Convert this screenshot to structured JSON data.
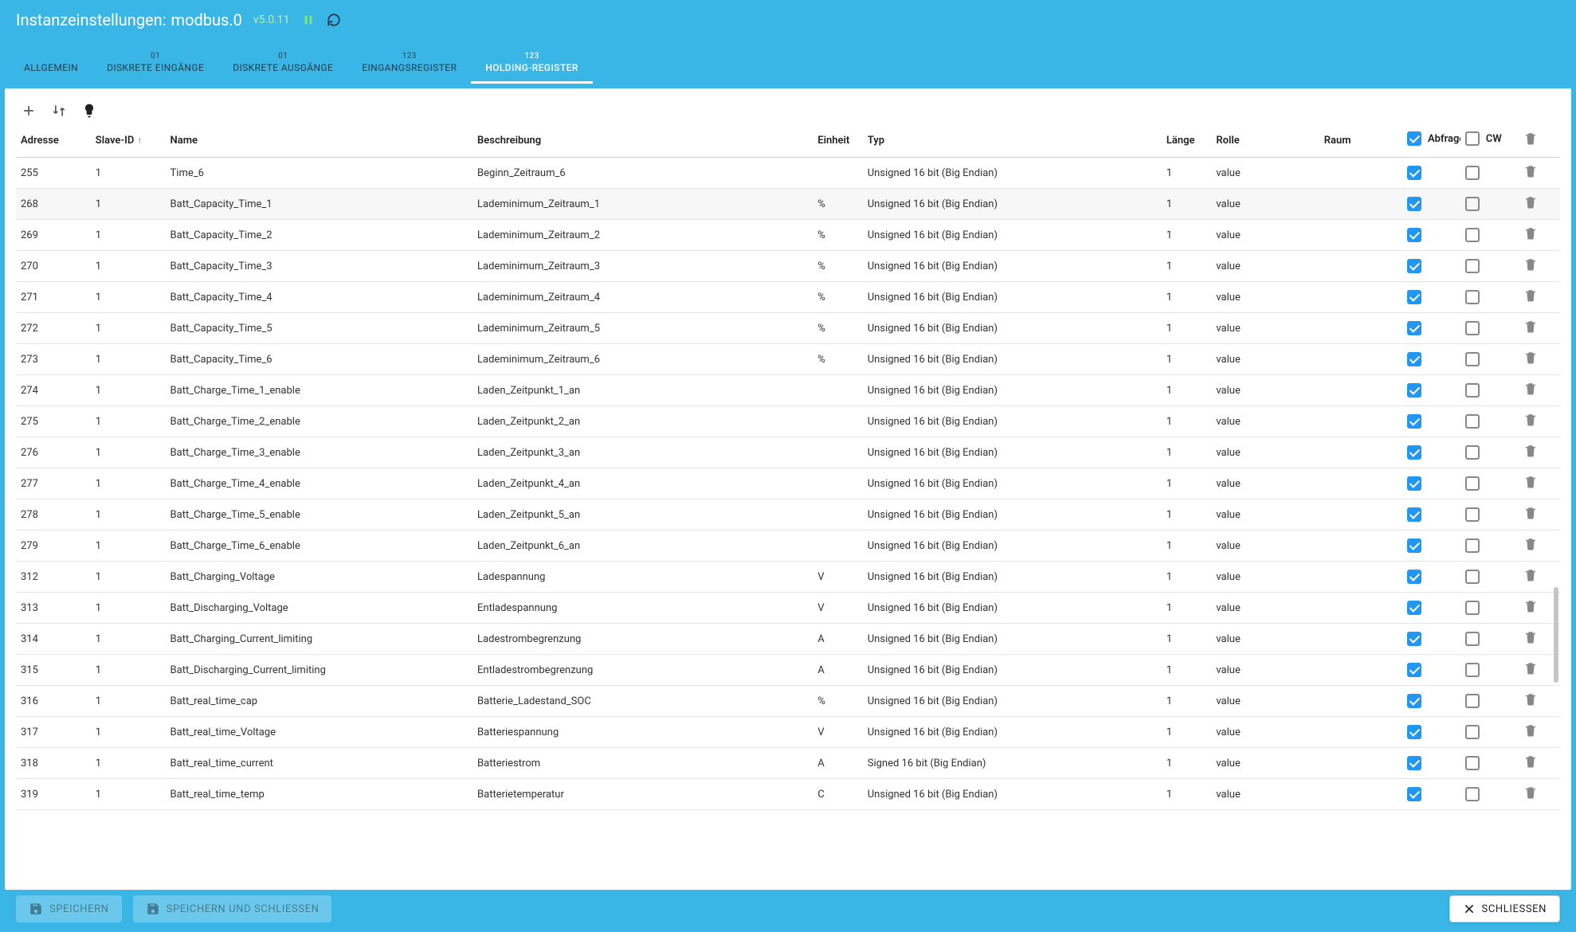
{
  "header": {
    "titlePrefix": "Instanzeinstellungen:",
    "instance": "modbus.0",
    "version": "v5.0.11"
  },
  "tabs": [
    {
      "caption": "",
      "label": "ALLGEMEIN"
    },
    {
      "caption": "01",
      "label": "DISKRETE EINGÄNGE"
    },
    {
      "caption": "01",
      "label": "DISKRETE AUSGÄNGE"
    },
    {
      "caption": "123",
      "label": "EINGANGSREGISTER"
    },
    {
      "caption": "123",
      "label": "HOLDING-REGISTER"
    }
  ],
  "activeTab": 4,
  "columns": {
    "adresse": "Adresse",
    "slave": "Slave-ID",
    "name": "Name",
    "beschreibung": "Beschreibung",
    "einheit": "Einheit",
    "typ": "Typ",
    "laenge": "Länge",
    "rolle": "Rolle",
    "raum": "Raum",
    "abfrage": "Abfrage",
    "cw": "CW"
  },
  "headerChecks": {
    "abfrage": true,
    "cw": false
  },
  "rows": [
    {
      "adresse": "255",
      "slave": "1",
      "name": "Time_6",
      "beschreibung": "Beginn_Zeitraum_6",
      "einheit": "",
      "typ": "Unsigned 16 bit (Big Endian)",
      "laenge": "1",
      "rolle": "value",
      "raum": "",
      "abfrage": true,
      "cw": false,
      "hover": false
    },
    {
      "adresse": "268",
      "slave": "1",
      "name": "Batt_Capacity_Time_1",
      "beschreibung": "Lademinimum_Zeitraum_1",
      "einheit": "%",
      "typ": "Unsigned 16 bit (Big Endian)",
      "laenge": "1",
      "rolle": "value",
      "raum": "",
      "abfrage": true,
      "cw": false,
      "hover": true
    },
    {
      "adresse": "269",
      "slave": "1",
      "name": "Batt_Capacity_Time_2",
      "beschreibung": "Lademinimum_Zeitraum_2",
      "einheit": "%",
      "typ": "Unsigned 16 bit (Big Endian)",
      "laenge": "1",
      "rolle": "value",
      "raum": "",
      "abfrage": true,
      "cw": false,
      "hover": false
    },
    {
      "adresse": "270",
      "slave": "1",
      "name": "Batt_Capacity_Time_3",
      "beschreibung": "Lademinimum_Zeitraum_3",
      "einheit": "%",
      "typ": "Unsigned 16 bit (Big Endian)",
      "laenge": "1",
      "rolle": "value",
      "raum": "",
      "abfrage": true,
      "cw": false,
      "hover": false
    },
    {
      "adresse": "271",
      "slave": "1",
      "name": "Batt_Capacity_Time_4",
      "beschreibung": "Lademinimum_Zeitraum_4",
      "einheit": "%",
      "typ": "Unsigned 16 bit (Big Endian)",
      "laenge": "1",
      "rolle": "value",
      "raum": "",
      "abfrage": true,
      "cw": false,
      "hover": false
    },
    {
      "adresse": "272",
      "slave": "1",
      "name": "Batt_Capacity_Time_5",
      "beschreibung": "Lademinimum_Zeitraum_5",
      "einheit": "%",
      "typ": "Unsigned 16 bit (Big Endian)",
      "laenge": "1",
      "rolle": "value",
      "raum": "",
      "abfrage": true,
      "cw": false,
      "hover": false
    },
    {
      "adresse": "273",
      "slave": "1",
      "name": "Batt_Capacity_Time_6",
      "beschreibung": "Lademinimum_Zeitraum_6",
      "einheit": "%",
      "typ": "Unsigned 16 bit (Big Endian)",
      "laenge": "1",
      "rolle": "value",
      "raum": "",
      "abfrage": true,
      "cw": false,
      "hover": false
    },
    {
      "adresse": "274",
      "slave": "1",
      "name": "Batt_Charge_Time_1_enable",
      "beschreibung": "Laden_Zeitpunkt_1_an",
      "einheit": "",
      "typ": "Unsigned 16 bit (Big Endian)",
      "laenge": "1",
      "rolle": "value",
      "raum": "",
      "abfrage": true,
      "cw": false,
      "hover": false
    },
    {
      "adresse": "275",
      "slave": "1",
      "name": "Batt_Charge_Time_2_enable",
      "beschreibung": "Laden_Zeitpunkt_2_an",
      "einheit": "",
      "typ": "Unsigned 16 bit (Big Endian)",
      "laenge": "1",
      "rolle": "value",
      "raum": "",
      "abfrage": true,
      "cw": false,
      "hover": false
    },
    {
      "adresse": "276",
      "slave": "1",
      "name": "Batt_Charge_Time_3_enable",
      "beschreibung": "Laden_Zeitpunkt_3_an",
      "einheit": "",
      "typ": "Unsigned 16 bit (Big Endian)",
      "laenge": "1",
      "rolle": "value",
      "raum": "",
      "abfrage": true,
      "cw": false,
      "hover": false
    },
    {
      "adresse": "277",
      "slave": "1",
      "name": "Batt_Charge_Time_4_enable",
      "beschreibung": "Laden_Zeitpunkt_4_an",
      "einheit": "",
      "typ": "Unsigned 16 bit (Big Endian)",
      "laenge": "1",
      "rolle": "value",
      "raum": "",
      "abfrage": true,
      "cw": false,
      "hover": false
    },
    {
      "adresse": "278",
      "slave": "1",
      "name": "Batt_Charge_Time_5_enable",
      "beschreibung": "Laden_Zeitpunkt_5_an",
      "einheit": "",
      "typ": "Unsigned 16 bit (Big Endian)",
      "laenge": "1",
      "rolle": "value",
      "raum": "",
      "abfrage": true,
      "cw": false,
      "hover": false
    },
    {
      "adresse": "279",
      "slave": "1",
      "name": "Batt_Charge_Time_6_enable",
      "beschreibung": "Laden_Zeitpunkt_6_an",
      "einheit": "",
      "typ": "Unsigned 16 bit (Big Endian)",
      "laenge": "1",
      "rolle": "value",
      "raum": "",
      "abfrage": true,
      "cw": false,
      "hover": false
    },
    {
      "adresse": "312",
      "slave": "1",
      "name": "Batt_Charging_Voltage",
      "beschreibung": "Ladespannung",
      "einheit": "V",
      "typ": "Unsigned 16 bit (Big Endian)",
      "laenge": "1",
      "rolle": "value",
      "raum": "",
      "abfrage": true,
      "cw": false,
      "hover": false
    },
    {
      "adresse": "313",
      "slave": "1",
      "name": "Batt_Discharging_Voltage",
      "beschreibung": "Entladespannung",
      "einheit": "V",
      "typ": "Unsigned 16 bit (Big Endian)",
      "laenge": "1",
      "rolle": "value",
      "raum": "",
      "abfrage": true,
      "cw": false,
      "hover": false
    },
    {
      "adresse": "314",
      "slave": "1",
      "name": "Batt_Charging_Current_limiting",
      "beschreibung": "Ladestrombegrenzung",
      "einheit": "A",
      "typ": "Unsigned 16 bit (Big Endian)",
      "laenge": "1",
      "rolle": "value",
      "raum": "",
      "abfrage": true,
      "cw": false,
      "hover": false
    },
    {
      "adresse": "315",
      "slave": "1",
      "name": "Batt_Discharging_Current_limiting",
      "beschreibung": "Entladestrombegrenzung",
      "einheit": "A",
      "typ": "Unsigned 16 bit (Big Endian)",
      "laenge": "1",
      "rolle": "value",
      "raum": "",
      "abfrage": true,
      "cw": false,
      "hover": false
    },
    {
      "adresse": "316",
      "slave": "1",
      "name": "Batt_real_time_cap",
      "beschreibung": "Batterie_Ladestand_SOC",
      "einheit": "%",
      "typ": "Unsigned 16 bit (Big Endian)",
      "laenge": "1",
      "rolle": "value",
      "raum": "",
      "abfrage": true,
      "cw": false,
      "hover": false
    },
    {
      "adresse": "317",
      "slave": "1",
      "name": "Batt_real_time_Voltage",
      "beschreibung": "Batteriespannung",
      "einheit": "V",
      "typ": "Unsigned 16 bit (Big Endian)",
      "laenge": "1",
      "rolle": "value",
      "raum": "",
      "abfrage": true,
      "cw": false,
      "hover": false
    },
    {
      "adresse": "318",
      "slave": "1",
      "name": "Batt_real_time_current",
      "beschreibung": "Batteriestrom",
      "einheit": "A",
      "typ": "Signed 16 bit (Big Endian)",
      "laenge": "1",
      "rolle": "value",
      "raum": "",
      "abfrage": true,
      "cw": false,
      "hover": false
    },
    {
      "adresse": "319",
      "slave": "1",
      "name": "Batt_real_time_temp",
      "beschreibung": "Batterietemperatur",
      "einheit": "C",
      "typ": "Unsigned 16 bit (Big Endian)",
      "laenge": "1",
      "rolle": "value",
      "raum": "",
      "abfrage": true,
      "cw": false,
      "hover": false
    }
  ],
  "footer": {
    "save": "SPEICHERN",
    "saveClose": "SPEICHERN UND SCHLIESSEN",
    "close": "SCHLIESSEN"
  }
}
